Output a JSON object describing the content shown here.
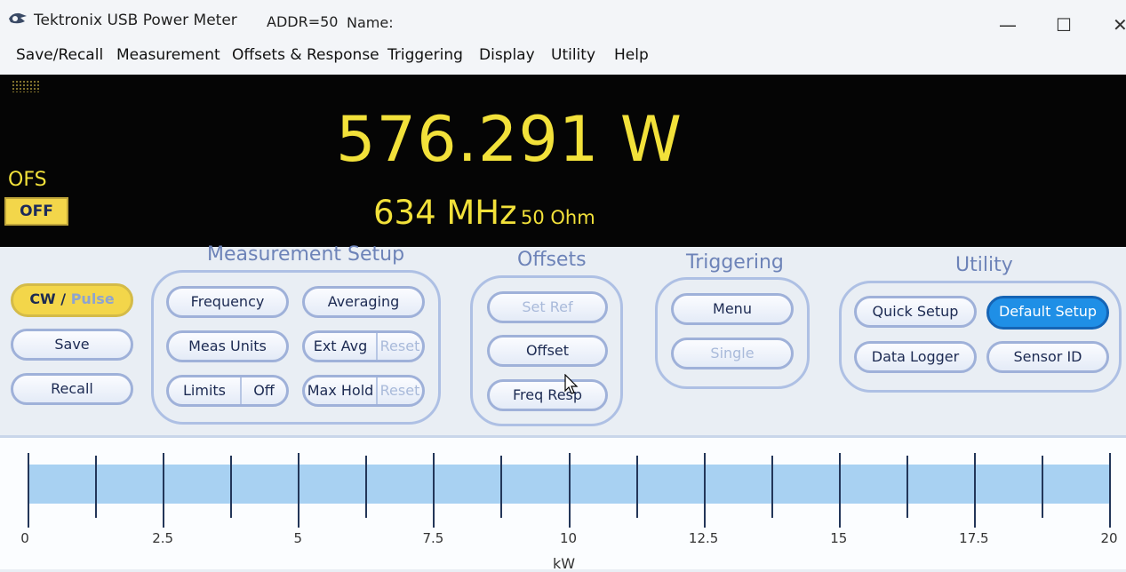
{
  "titlebar": {
    "app_title": "Tektronix USB Power Meter",
    "address": "ADDR=50",
    "name_label": "Name:",
    "minimize": "—",
    "maximize": "☐",
    "close": "✕"
  },
  "menu": [
    "Save/Recall",
    "Measurement",
    "Offsets & Response",
    "Triggering",
    "Display",
    "Utility",
    "Help"
  ],
  "display": {
    "reading": "576.291 W",
    "frequency": "634 MHz",
    "impedance": "50 Ohm",
    "ofs_label": "OFS",
    "ofs_button": "OFF",
    "accent_color": "#f2e13a"
  },
  "left_buttons": {
    "mode_cw": "CW",
    "mode_sep": "/",
    "mode_pulse": "Pulse",
    "save": "Save",
    "recall": "Recall"
  },
  "measurement_setup": {
    "title": "Measurement Setup",
    "frequency": "Frequency",
    "averaging": "Averaging",
    "meas_units": "Meas Units",
    "ext_avg": "Ext Avg",
    "ext_avg_reset": "Reset",
    "limits": "Limits",
    "limits_value": "Off",
    "max_hold": "Max Hold",
    "max_hold_reset": "Reset"
  },
  "offsets": {
    "title": "Offsets",
    "set_ref": "Set Ref",
    "offset": "Offset",
    "freq_resp": "Freq Resp"
  },
  "triggering": {
    "title": "Triggering",
    "menu": "Menu",
    "single": "Single"
  },
  "utility": {
    "title": "Utility",
    "quick_setup": "Quick Setup",
    "default_setup": "Default Setup",
    "data_logger": "Data Logger",
    "sensor_id": "Sensor ID"
  },
  "bar_graph": {
    "unit": "kW",
    "min": 0,
    "max": 20,
    "labels": [
      "0",
      "2.5",
      "5",
      "7.5",
      "10",
      "12.5",
      "15",
      "17.5",
      "20"
    ]
  }
}
